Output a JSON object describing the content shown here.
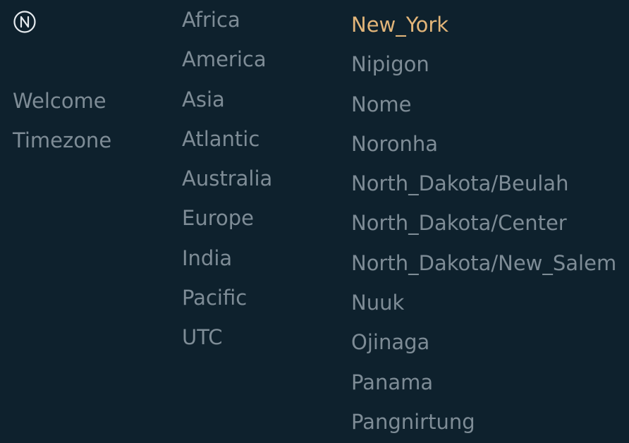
{
  "app": {
    "logo_icon": "moodeaudio-logo-icon"
  },
  "nav": {
    "items": [
      {
        "label": "Welcome"
      },
      {
        "label": "Timezone"
      }
    ]
  },
  "regions": {
    "items": [
      {
        "label": "Africa"
      },
      {
        "label": "America"
      },
      {
        "label": "Asia"
      },
      {
        "label": "Atlantic"
      },
      {
        "label": "Australia"
      },
      {
        "label": "Europe"
      },
      {
        "label": "India"
      },
      {
        "label": "Pacific"
      },
      {
        "label": "UTC"
      }
    ]
  },
  "cities": {
    "selected": "New_York",
    "items": [
      {
        "label": "New_York"
      },
      {
        "label": "Nipigon"
      },
      {
        "label": "Nome"
      },
      {
        "label": "Noronha"
      },
      {
        "label": "North_Dakota/Beulah"
      },
      {
        "label": "North_Dakota/Center"
      },
      {
        "label": "North_Dakota/New_Salem"
      },
      {
        "label": "Nuuk"
      },
      {
        "label": "Ojinaga"
      },
      {
        "label": "Panama"
      },
      {
        "label": "Pangnirtung"
      }
    ]
  },
  "colors": {
    "background": "#0e212d",
    "text": "#7e8c96",
    "accent": "#e2b579",
    "logo": "#e6ebef"
  }
}
